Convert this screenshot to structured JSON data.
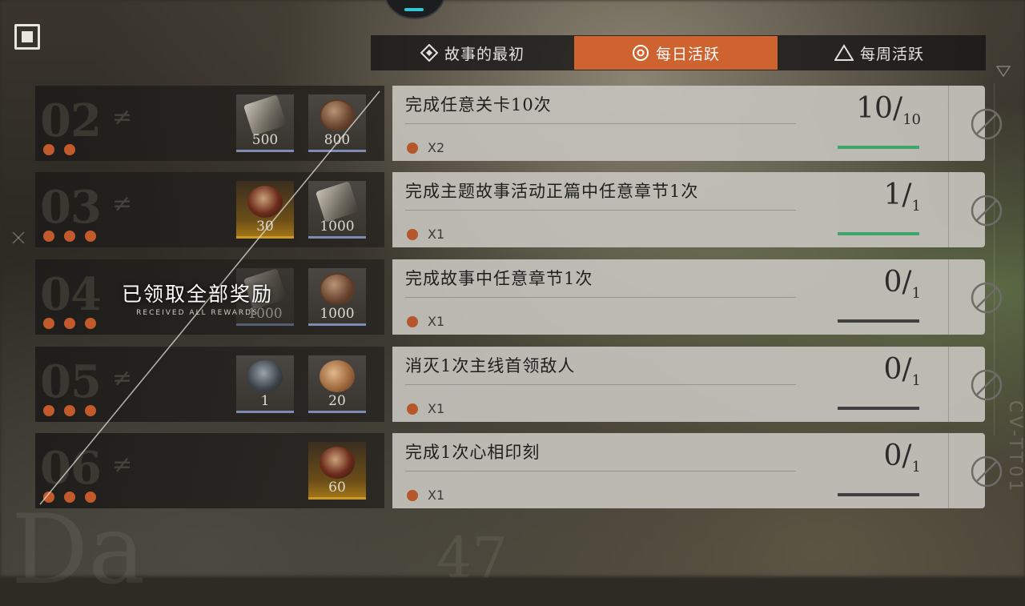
{
  "tabs": [
    {
      "label": "故事的最初",
      "icon": "diamond-icon",
      "active": false
    },
    {
      "label": "每日活跃",
      "icon": "circle-target-icon",
      "active": true
    },
    {
      "label": "每周活跃",
      "icon": "triangle-icon",
      "active": false
    }
  ],
  "received": {
    "title": "已领取全部奖励",
    "subtitle": "RECEIVED ALL REWARDS"
  },
  "milestones": [
    {
      "level": "02",
      "dots": 2,
      "rewards": [
        {
          "item": "shard",
          "qty": "500"
        },
        {
          "item": "coin",
          "qty": "800"
        }
      ]
    },
    {
      "level": "03",
      "dots": 3,
      "rewards": [
        {
          "item": "orb",
          "qty": "30"
        },
        {
          "item": "shard",
          "qty": "1000"
        }
      ]
    },
    {
      "level": "04",
      "dots": 3,
      "rewards": [
        {
          "item": "shard",
          "qty": "1000"
        },
        {
          "item": "coin",
          "qty": "1000"
        }
      ]
    },
    {
      "level": "05",
      "dots": 3,
      "rewards": [
        {
          "item": "sphere",
          "qty": "1"
        },
        {
          "item": "shell",
          "qty": "20"
        }
      ]
    },
    {
      "level": "06",
      "dots": 3,
      "rewards": [
        {
          "item": "orb",
          "qty": "60"
        }
      ]
    }
  ],
  "tasks": [
    {
      "title": "完成任意关卡10次",
      "multiplier": "X2",
      "current": "10",
      "total": "10",
      "progress": 1.0
    },
    {
      "title": "完成主题故事活动正篇中任意章节1次",
      "multiplier": "X1",
      "current": "1",
      "total": "1",
      "progress": 1.0
    },
    {
      "title": "完成故事中任意章节1次",
      "multiplier": "X1",
      "current": "0",
      "total": "1",
      "progress": 0.0
    },
    {
      "title": "消灭1次主线首领敌人",
      "multiplier": "X1",
      "current": "0",
      "total": "1",
      "progress": 0.0
    },
    {
      "title": "完成1次心相印刻",
      "multiplier": "X1",
      "current": "0",
      "total": "1",
      "progress": 0.0
    }
  ],
  "background": {
    "text_left": "Da",
    "text_mid": "47",
    "text_side": "CV-TT01"
  },
  "colors": {
    "accent": "#cf6330",
    "progress": "#3fa56a",
    "dot": "#c35a2c"
  }
}
